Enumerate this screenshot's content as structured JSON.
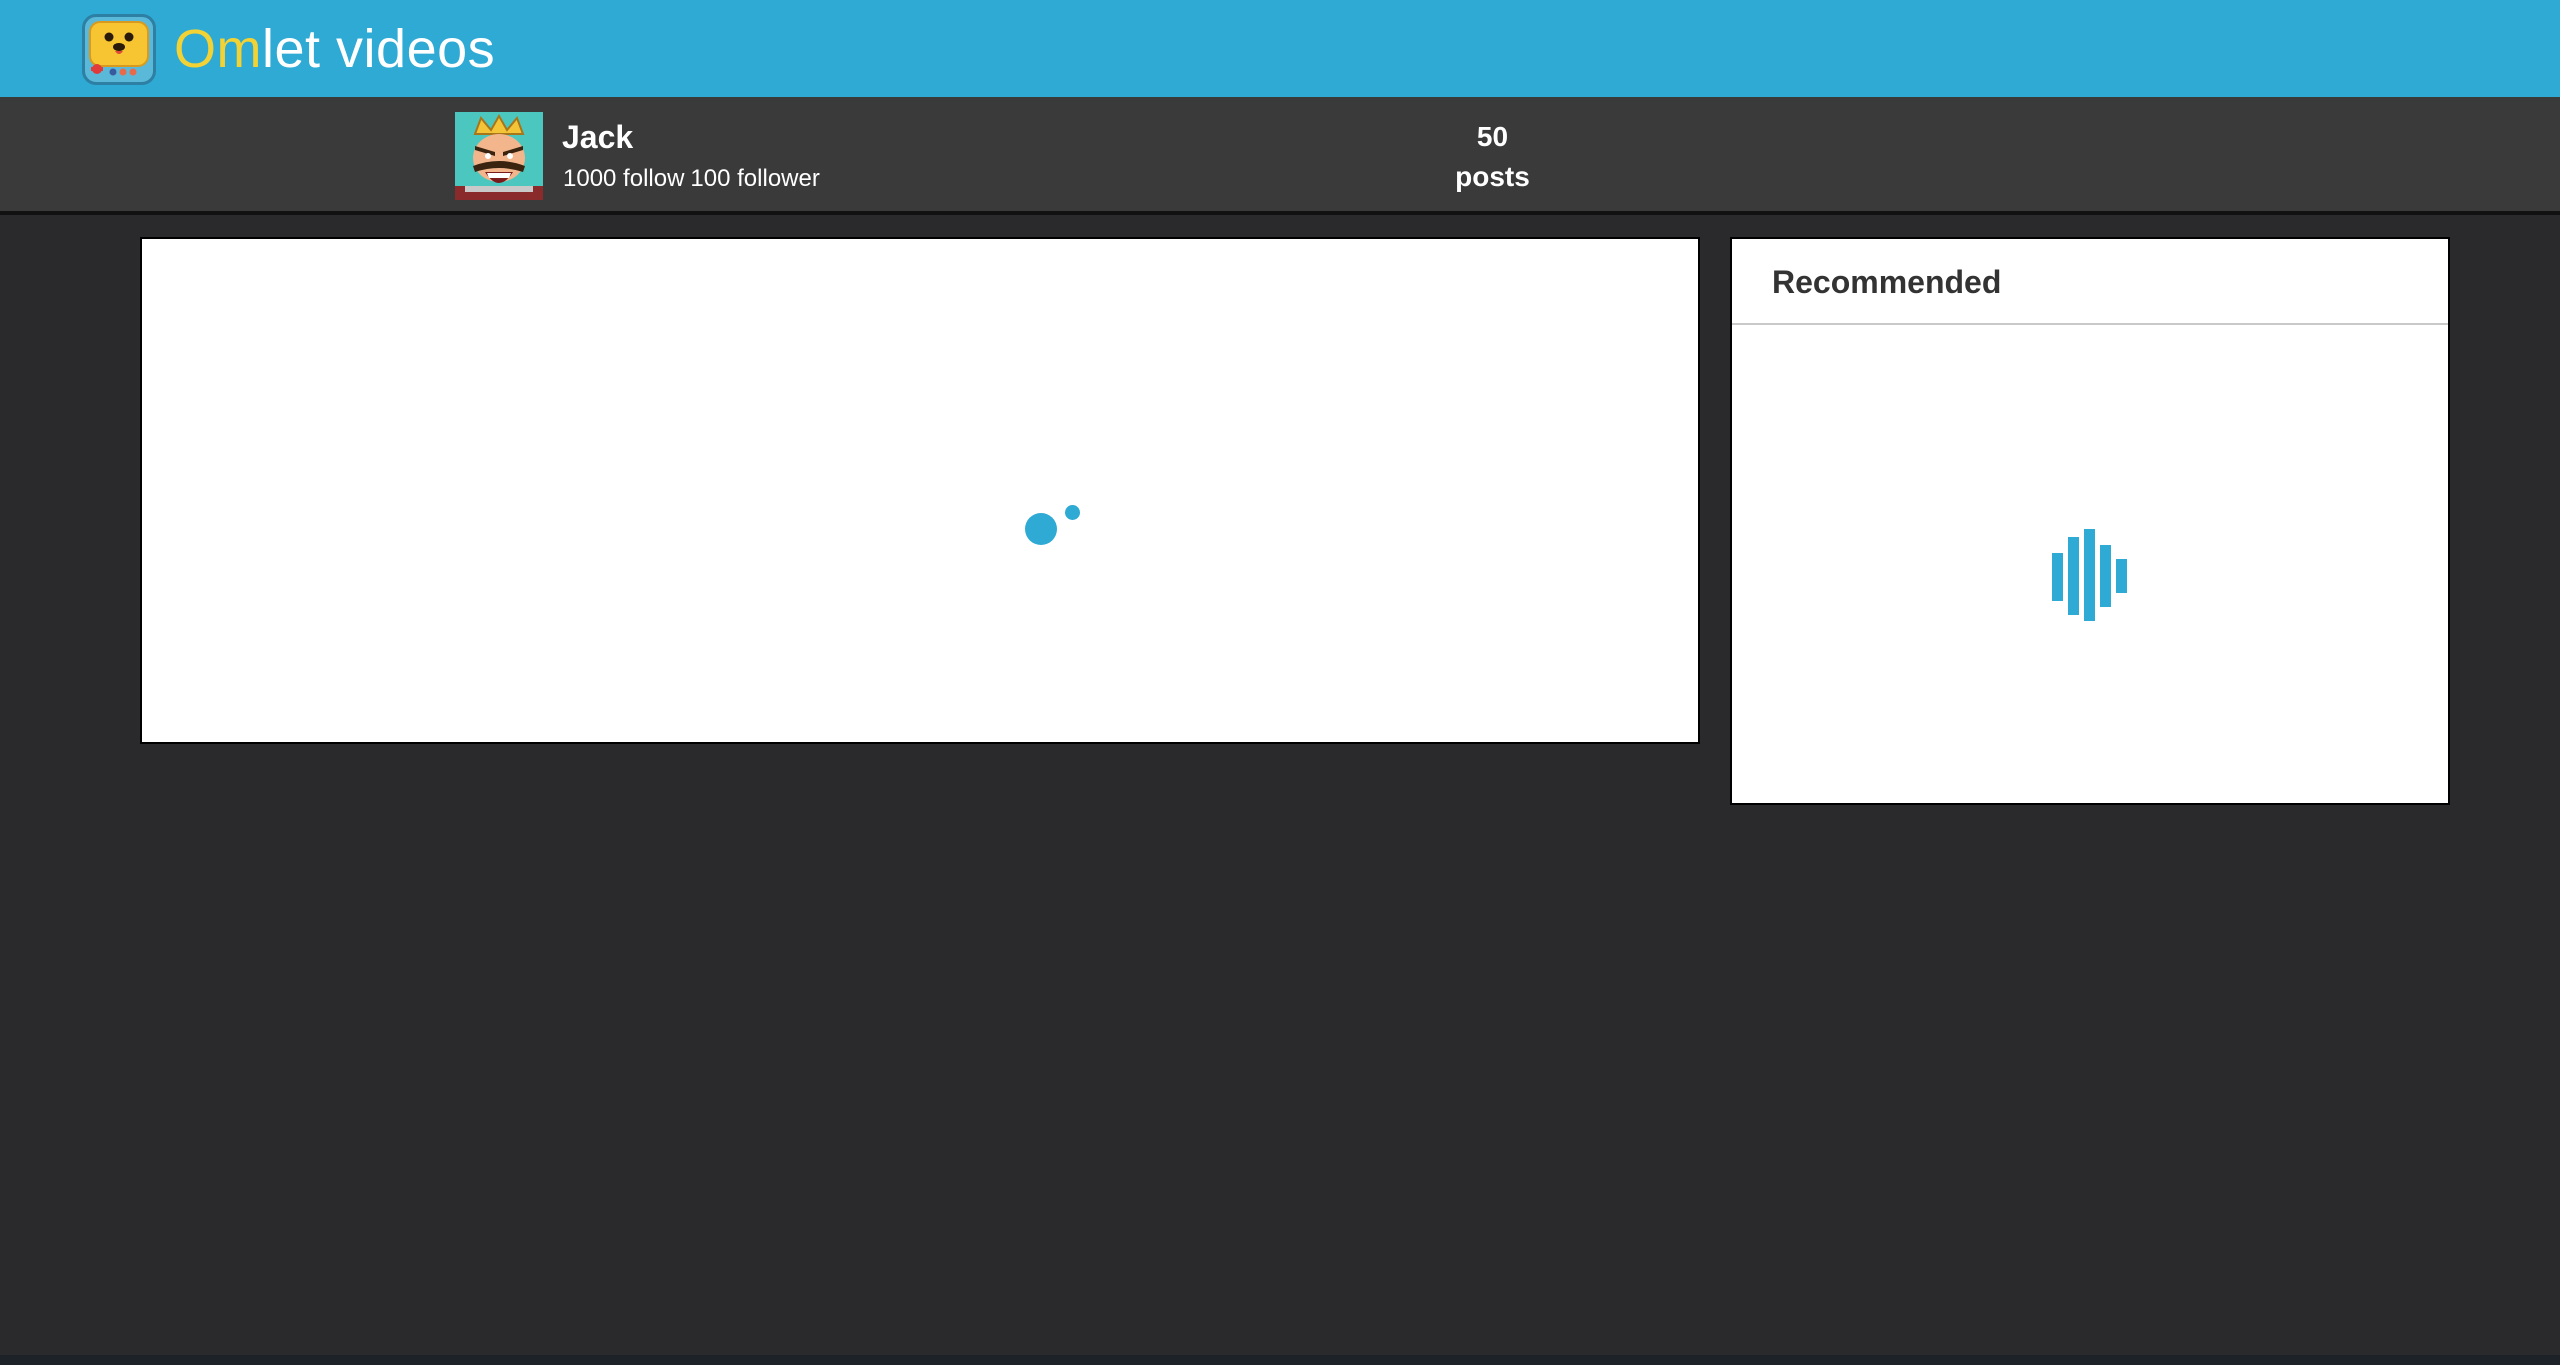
{
  "header": {
    "brand_part1": "Om",
    "brand_part2": "let videos",
    "logo_icon": "omlet-logo-icon",
    "colors": {
      "background": "#2eaad4",
      "brand_accent": "#f2d234",
      "text": "#ffffff"
    }
  },
  "profile": {
    "username": "Jack",
    "follow": "1000 follow",
    "follower": "100 follower",
    "posts_count": "50",
    "posts_label": "posts",
    "avatar_icon": "user-avatar"
  },
  "main": {
    "loader_icon": "dots-loading-icon"
  },
  "recommended": {
    "title": "Recommended",
    "loader_icon": "bars-loading-icon"
  },
  "colors": {
    "page_background": "#2a2a2c",
    "profile_bar": "#3a3a3a",
    "accent": "#2eaad4",
    "panel": "#ffffff"
  }
}
